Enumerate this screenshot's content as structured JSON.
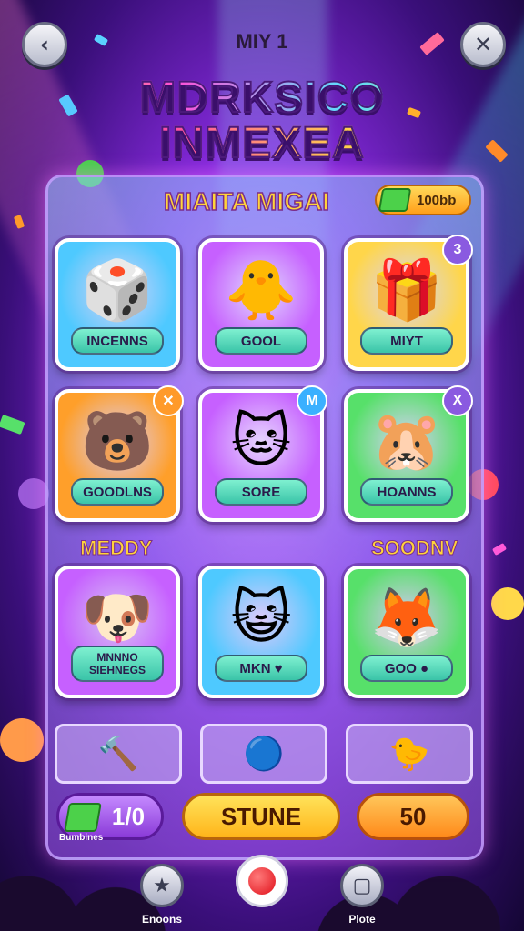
{
  "header": {
    "back_icon": "chevron-left",
    "close_icon": "x",
    "level_text": "MIY 1",
    "logo_line1": "MDRKSICO",
    "logo_line2": "INMEXEA"
  },
  "panel": {
    "title": "MIAITA MIGAI",
    "currency": "100bb",
    "currency_icon": "green-gem"
  },
  "cards": [
    {
      "label": "INCENNS",
      "art": "🎲",
      "color": "#4ec9ff",
      "badge": ""
    },
    {
      "label": "GOOL",
      "art": "🐥",
      "color": "#c660ff",
      "badge": ""
    },
    {
      "label": "MIYT",
      "art": "🎁",
      "color": "#ffd64a",
      "badge": "3"
    },
    {
      "label": "GOODLNS",
      "art": "🐻",
      "color": "#ff9f2a",
      "badge": "✕"
    },
    {
      "label": "SORE",
      "art": "🐱",
      "color": "#c660ff",
      "badge": "M"
    },
    {
      "label": "HOANNS",
      "art": "🐹",
      "color": "#57e06a",
      "badge": "X"
    },
    {
      "label": "MNNNO SIEHNEGS",
      "art": "🐶",
      "color": "#c660ff",
      "badge": ""
    },
    {
      "label": "MKN ♥",
      "art": "😺",
      "color": "#4ec9ff",
      "badge": ""
    },
    {
      "label": "GOO ●",
      "art": "🦊",
      "color": "#57e06a",
      "badge": ""
    }
  ],
  "sections": {
    "left": "MEDDY",
    "right": "SOODNV"
  },
  "bottom_slots": [
    {
      "art": "🔨"
    },
    {
      "art": "🔵"
    },
    {
      "art": "🐤"
    }
  ],
  "counter": {
    "value": "1/0",
    "caption": "Bumbines"
  },
  "actions": {
    "primary": "STUNE",
    "secondary": "50"
  },
  "nav": [
    {
      "label": "Enoons",
      "icon": "star"
    },
    {
      "label": "",
      "icon": "record"
    },
    {
      "label": "Plote",
      "icon": "square"
    }
  ]
}
